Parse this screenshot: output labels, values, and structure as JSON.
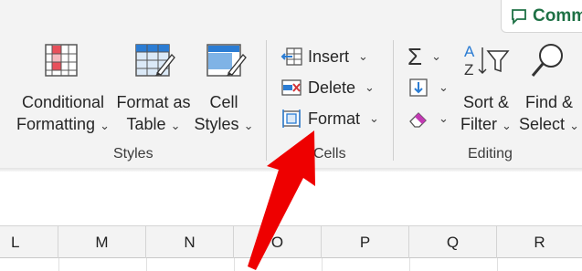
{
  "comments_button": {
    "label": "Comm"
  },
  "styles_group": {
    "label": "Styles",
    "conditional_formatting": {
      "line1": "Conditional",
      "line2": "Formatting"
    },
    "format_as_table": {
      "line1": "Format as",
      "line2": "Table"
    },
    "cell_styles": {
      "line1": "Cell",
      "line2": "Styles"
    }
  },
  "cells_group": {
    "label": "Cells",
    "insert": "Insert",
    "delete": "Delete",
    "format": "Format"
  },
  "editing_group": {
    "label": "Editing",
    "sort_filter": {
      "line1": "Sort &",
      "line2": "Filter"
    },
    "find_select": {
      "line1": "Find &",
      "line2": "Select"
    }
  },
  "chevron": "⌄",
  "columns": [
    "L",
    "M",
    "N",
    "O",
    "P",
    "Q",
    "R"
  ],
  "colors": {
    "accent_green": "#1e7145",
    "arrow_red": "#ee0000",
    "icon_blue": "#2b7cd3",
    "icon_red": "#e8505b"
  }
}
